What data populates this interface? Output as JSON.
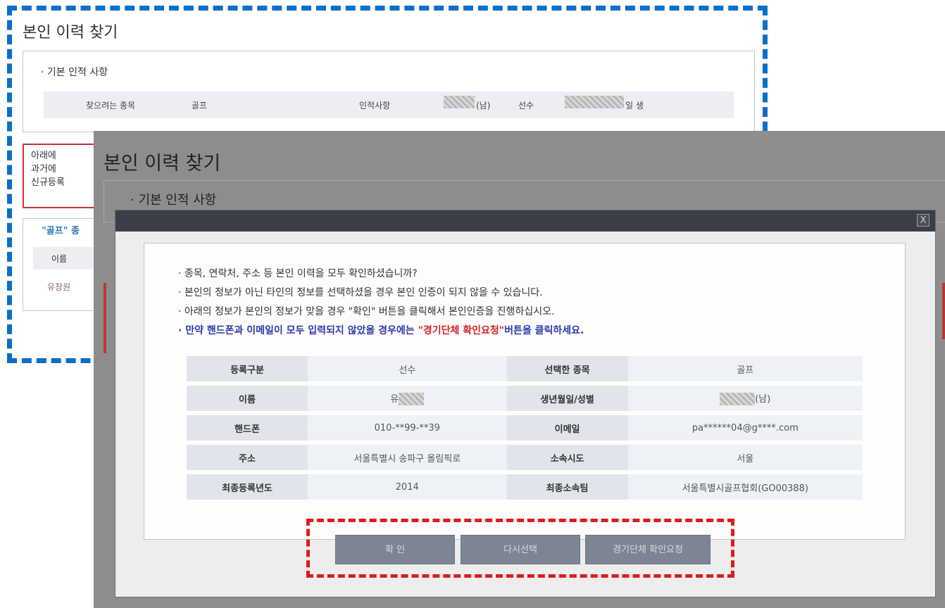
{
  "back": {
    "title": "본인 이력 찾기",
    "section_title": "· 기본 인적 사항",
    "row": {
      "label1": "찾으려는 종목",
      "value1": "골프",
      "label2": "인적사항",
      "gender": "(남)",
      "role": "선수",
      "suffix": "일 생"
    },
    "warning_lines": [
      "아래에",
      "과거에",
      "신규등록"
    ],
    "list_heading": "\"골프\" 종",
    "list_col": "이름",
    "list_row": "유창원"
  },
  "overlay": {
    "title": "본인 이력 찾기",
    "section_title": "· 기본 인적 사항"
  },
  "modal": {
    "close_label": "X",
    "notes": [
      "· 종목, 연락처, 주소 등 본인 이력을 모두 확인하셨습니까?",
      "· 본인의 정보가 아닌 타인의 정보를 선택하셨을 경우 본인 인증이 되지 않을 수 있습니다.",
      "· 아래의 정보가 본인의 정보가 맞을 경우 \"확인\" 버튼을 클릭해서 본인인증을 진행하십시오."
    ],
    "note4": {
      "before": "· 만약 핸드폰과 이메일이 모두 입력되지 않았을 경우에는 ",
      "emphasis": "\"경기단체 확인요청\"",
      "after": "버튼을 클릭하세요."
    },
    "table": [
      {
        "l1": "등록구분",
        "v1": "선수",
        "l2": "선택한 종목",
        "v2": "골프"
      },
      {
        "l1": "이름",
        "v1": "유",
        "l2": "생년월일/성별",
        "v2": "(남)"
      },
      {
        "l1": "핸드폰",
        "v1": "010-**99-**39",
        "l2": "이메일",
        "v2": "pa******04@g****.com"
      },
      {
        "l1": "주소",
        "v1": "서울특별시 송파구 올림픽로",
        "l2": "소속시도",
        "v2": "서울"
      },
      {
        "l1": "최종등록년도",
        "v1": "2014",
        "l2": "최종소속팀",
        "v2": "서울특별시골프협회(GO00388)"
      }
    ],
    "buttons": {
      "confirm": "확 인",
      "reselect": "다시선택",
      "request": "경기단체 확인요청"
    }
  },
  "colors": {
    "blue_dash": "#0a6fc9",
    "red_dash": "#e01b1b",
    "button_bg": "#7d8594",
    "modal_header": "#3a3f47"
  }
}
